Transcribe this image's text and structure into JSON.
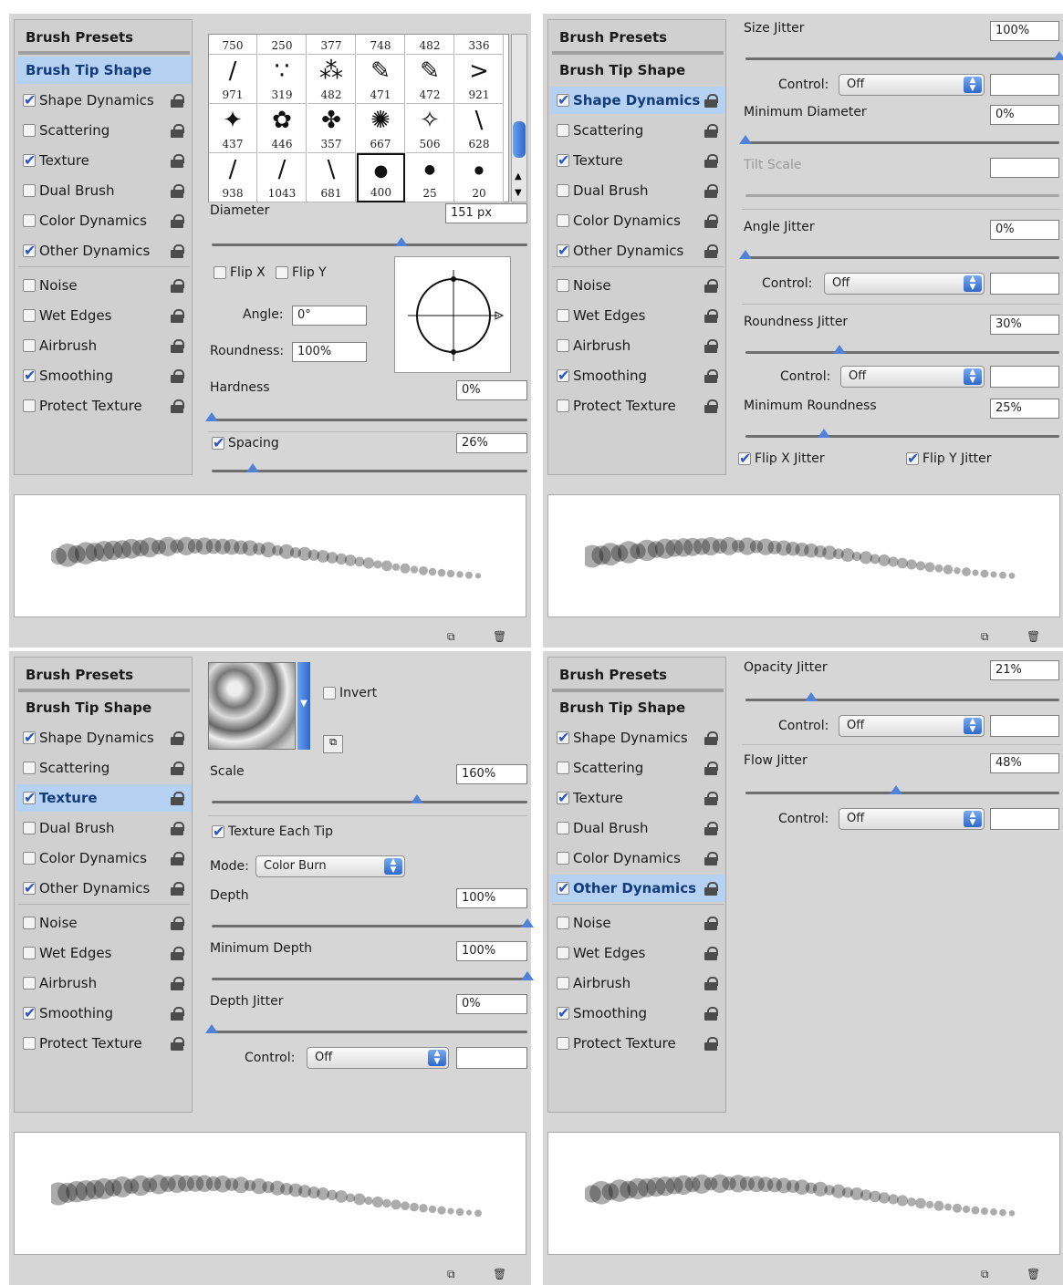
{
  "sidebar_items": [
    "Brush Presets",
    "Brush Tip Shape",
    "Shape Dynamics",
    "Scattering",
    "Texture",
    "Dual Brush",
    "Color Dynamics",
    "Other Dynamics",
    "Noise",
    "Wet Edges",
    "Airbrush",
    "Smoothing",
    "Protect Texture"
  ],
  "panel1": {
    "checks": [
      true,
      false,
      true,
      false,
      false,
      true,
      false,
      false,
      false,
      true,
      false
    ],
    "tips_row1": [
      "750",
      "250",
      "377",
      "748",
      "482",
      "336"
    ],
    "tips_row2": [
      "971",
      "319",
      "482",
      "471",
      "472",
      "921"
    ],
    "tips_row3": [
      "437",
      "446",
      "357",
      "667",
      "506",
      "628"
    ],
    "tips_row4": [
      "938",
      "1043",
      "681",
      "400",
      "25",
      "20"
    ],
    "diameter_label": "Diameter",
    "diameter_value": "151 px",
    "diameter_pct": 0.6,
    "flipx": "Flip X",
    "flipy": "Flip Y",
    "angle_label": "Angle:",
    "angle_value": "0°",
    "roundness_label": "Roundness:",
    "roundness_value": "100%",
    "hardness_label": "Hardness",
    "hardness_value": "0%",
    "hardness_pct": 0.0,
    "spacing_label": "Spacing",
    "spacing_value": "26%",
    "spacing_pct": 0.13
  },
  "panel2": {
    "checks": [
      true,
      false,
      true,
      false,
      false,
      true,
      false,
      false,
      false,
      true,
      false
    ],
    "size_jitter_label": "Size Jitter",
    "size_jitter_value": "100%",
    "size_jitter_pct": 1.0,
    "control_label": "Control:",
    "control_value": "Off",
    "min_diameter_label": "Minimum Diameter",
    "min_diameter_value": "0%",
    "min_diameter_pct": 0.0,
    "tilt_scale_label": "Tilt Scale",
    "angle_jitter_label": "Angle Jitter",
    "angle_jitter_value": "0%",
    "angle_jitter_pct": 0.0,
    "roundness_jitter_label": "Roundness Jitter",
    "roundness_jitter_value": "30%",
    "roundness_jitter_pct": 0.3,
    "min_roundness_label": "Minimum Roundness",
    "min_roundness_value": "25%",
    "min_roundness_pct": 0.25,
    "flipx_jitter": "Flip X Jitter",
    "flipy_jitter": "Flip Y Jitter"
  },
  "panel3": {
    "checks": [
      true,
      false,
      true,
      false,
      false,
      true,
      false,
      false,
      false,
      true,
      false
    ],
    "invert_label": "Invert",
    "scale_label": "Scale",
    "scale_value": "160%",
    "scale_pct": 0.65,
    "texture_each_tip": "Texture Each Tip",
    "mode_label": "Mode:",
    "mode_value": "Color Burn",
    "depth_label": "Depth",
    "depth_value": "100%",
    "depth_pct": 1.0,
    "min_depth_label": "Minimum Depth",
    "min_depth_value": "100%",
    "min_depth_pct": 1.0,
    "depth_jitter_label": "Depth Jitter",
    "depth_jitter_value": "0%",
    "depth_jitter_pct": 0.0,
    "control_label": "Control:",
    "control_value": "Off"
  },
  "panel4": {
    "checks": [
      true,
      false,
      true,
      false,
      false,
      true,
      false,
      false,
      false,
      true,
      false
    ],
    "opacity_jitter_label": "Opacity Jitter",
    "opacity_jitter_value": "21%",
    "opacity_jitter_pct": 0.21,
    "control_label": "Control:",
    "control_value": "Off",
    "flow_jitter_label": "Flow Jitter",
    "flow_jitter_value": "48%",
    "flow_jitter_pct": 0.48
  },
  "colors": {
    "panel_bg": "#d6d6d6",
    "selected": "#b6d2f3",
    "slider_thumb": "#4f82d8"
  }
}
